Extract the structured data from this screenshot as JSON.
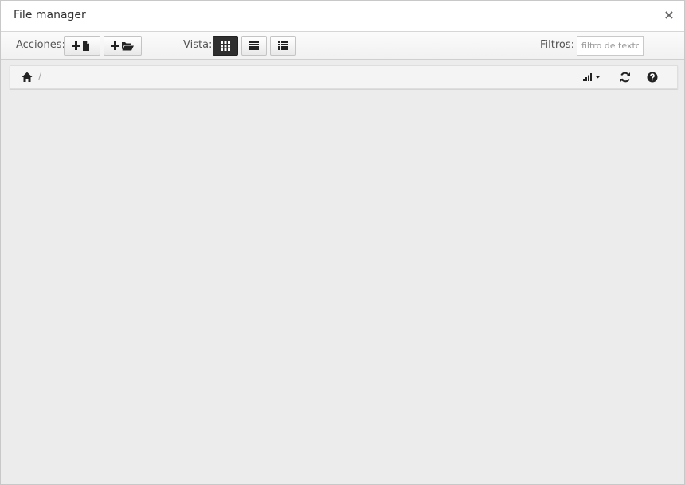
{
  "window": {
    "title": "File manager",
    "close_symbol": "×"
  },
  "toolbar": {
    "actions_label": "Acciones:",
    "view_label": "Vista:",
    "filters_label": "Filtros:",
    "filter_placeholder": "filtro de texto.",
    "filter_value": "",
    "actions": [
      {
        "name": "add-file-button",
        "icon": "plus-file-icon"
      },
      {
        "name": "add-folder-button",
        "icon": "plus-folder-icon"
      }
    ],
    "views": [
      {
        "name": "view-grid-button",
        "icon": "grid-icon",
        "active": true
      },
      {
        "name": "view-list-button",
        "icon": "list-icon",
        "active": false
      },
      {
        "name": "view-details-button",
        "icon": "details-icon",
        "active": false
      }
    ]
  },
  "pathbar": {
    "separator": "/",
    "icons": [
      "home-icon",
      "sort-icon",
      "refresh-icon",
      "help-icon"
    ]
  },
  "colors": {
    "active_view": "#2f2f2f",
    "background": "#ececec"
  }
}
